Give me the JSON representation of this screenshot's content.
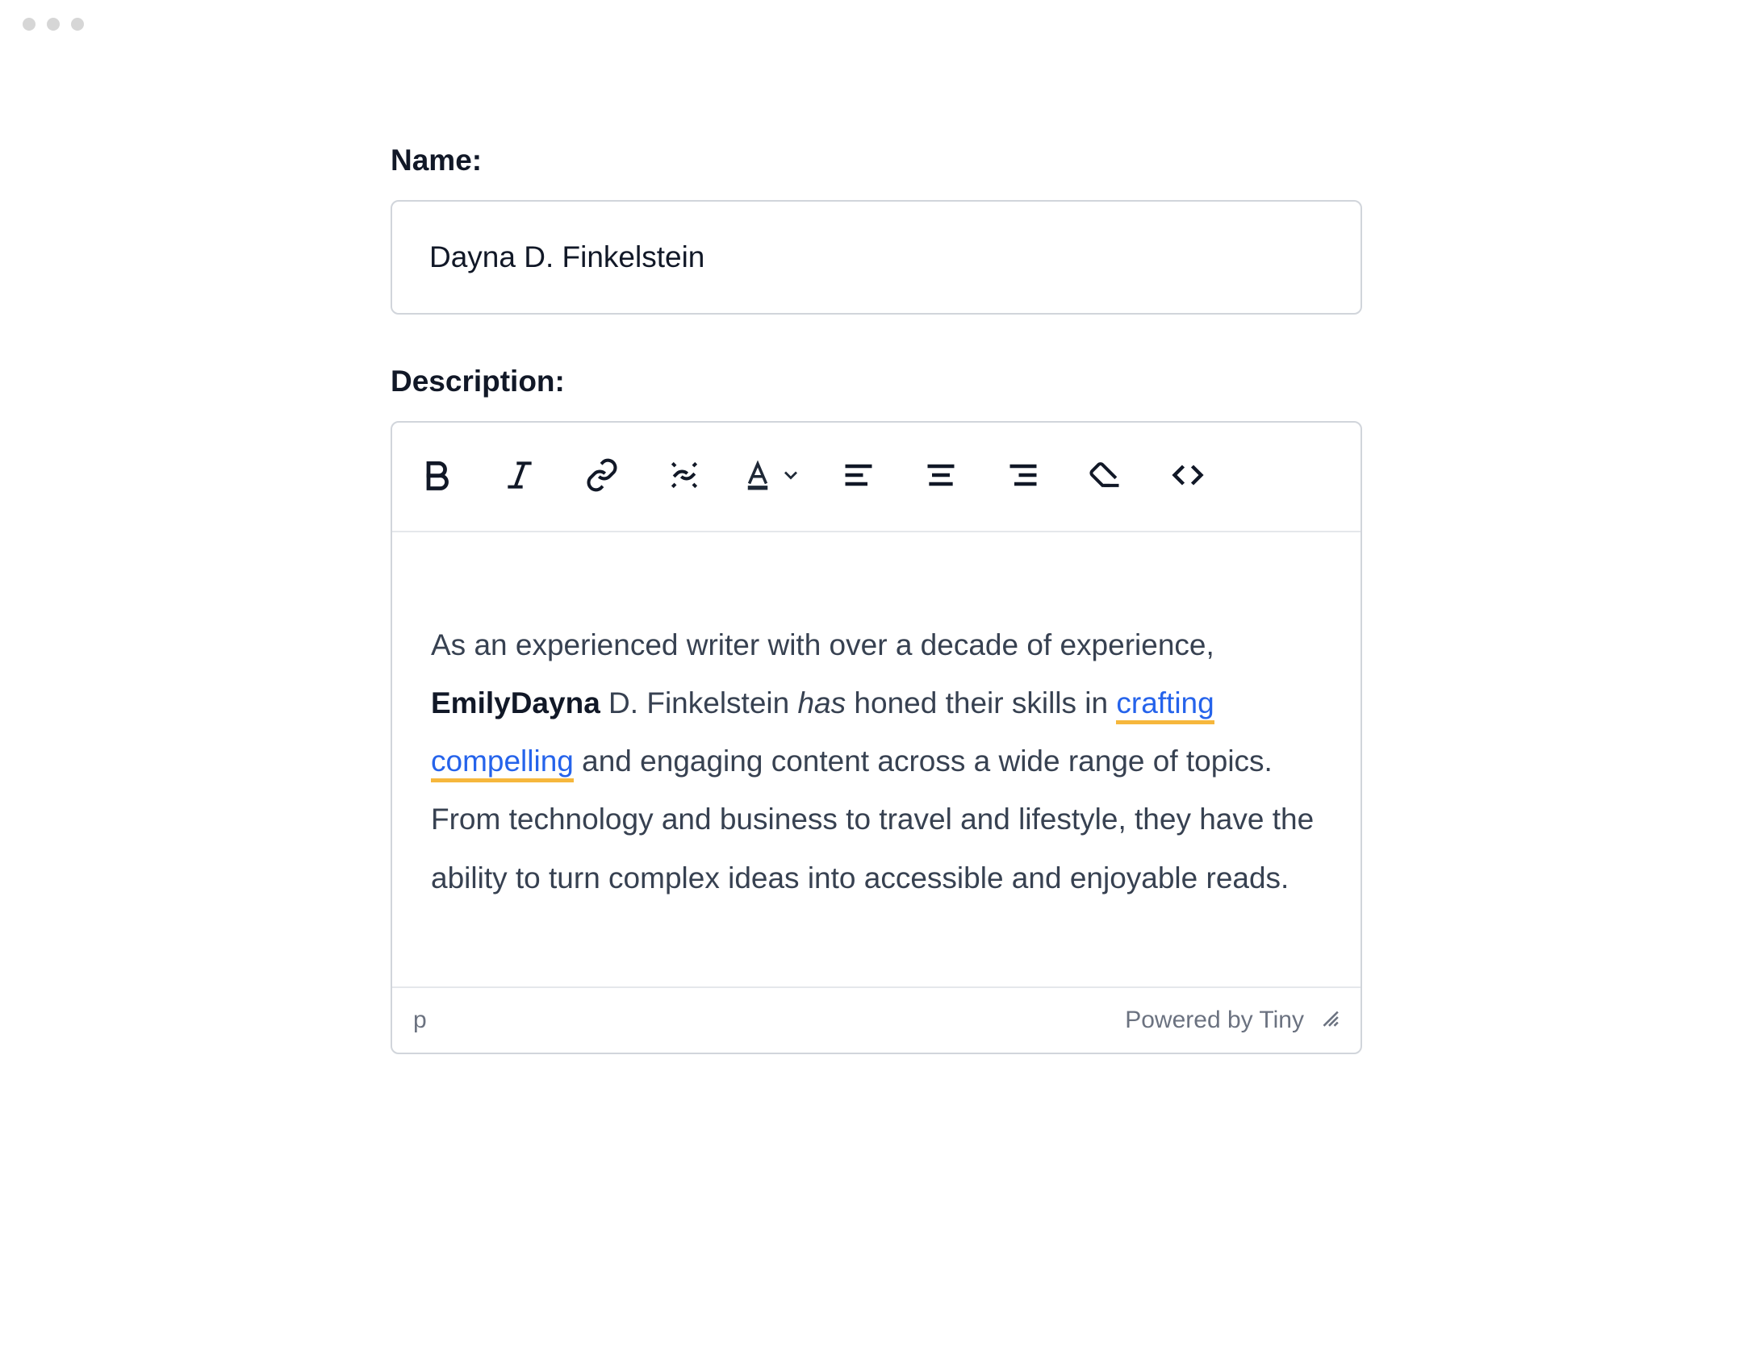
{
  "labels": {
    "name": "Name:",
    "description": "Description:"
  },
  "name_value": "Dayna D. Finkelstein",
  "description": {
    "t1": "As an experienced writer with over a decade of experience, ",
    "bold": "EmilyDayna",
    "t2": " D. Finkelstein ",
    "italic": "has",
    "t3": " honed their skills in ",
    "link": "crafting compelling",
    "t4": " and engaging content across a wide range of topics. From technology and business to travel and lifestyle, they have the ability to turn complex ideas into accessible and enjoyable reads."
  },
  "statusbar": {
    "path": "p",
    "powered": "Powered by Tiny"
  }
}
